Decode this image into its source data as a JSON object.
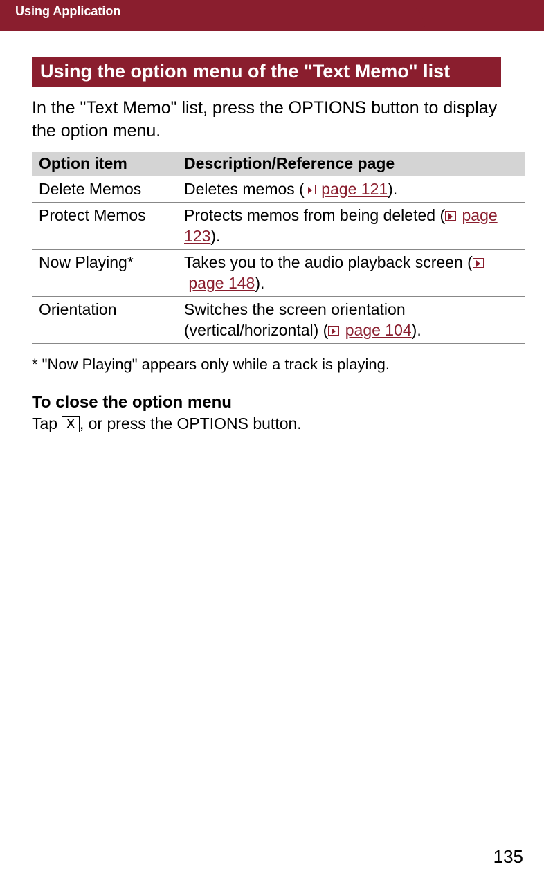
{
  "header": {
    "breadcrumb": "Using Application"
  },
  "section": {
    "title": "Using the option menu of the \"Text Memo\" list",
    "intro": "In the \"Text Memo\" list, press the OPTIONS button to display the option menu."
  },
  "table": {
    "headers": {
      "col1": "Option item",
      "col2": "Description/Reference page"
    },
    "rows": [
      {
        "item": "Delete Memos",
        "desc_pre": "Deletes memos (",
        "page_link": "page 121",
        "desc_post": ")."
      },
      {
        "item": "Protect Memos",
        "desc_pre": "Protects memos from being deleted (",
        "page_link": "page 123",
        "desc_post": ")."
      },
      {
        "item": "Now Playing*",
        "desc_pre": "Takes you to the audio playback screen (",
        "page_link": "page 148",
        "desc_post": ")."
      },
      {
        "item": "Orientation",
        "desc_pre": "Switches the screen orientation (vertical/horizontal) (",
        "page_link": "page 104",
        "desc_post": ")."
      }
    ]
  },
  "footnote": "*  \"Now Playing\" appears only while a track is playing.",
  "close_section": {
    "heading": "To close the option menu",
    "text_pre": "Tap ",
    "x_symbol": "X",
    "text_post": ", or press the OPTIONS button."
  },
  "page_number": "135"
}
